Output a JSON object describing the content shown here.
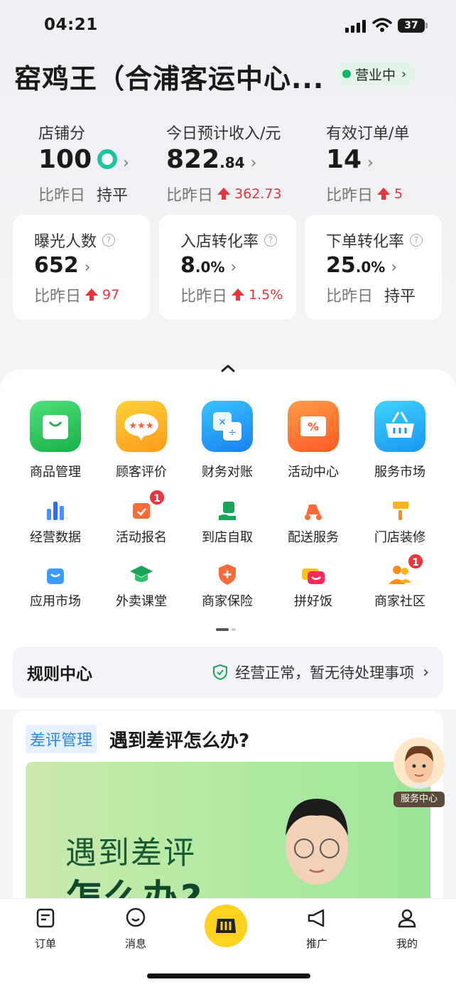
{
  "status_bar": {
    "time": "04:21",
    "battery": "37"
  },
  "store": {
    "name": "窑鸡王（合浦客运中心...",
    "status": "营业中"
  },
  "metrics": [
    {
      "label": "店铺分",
      "value": "100",
      "compare_label": "比昨日",
      "compare_value": "持平"
    },
    {
      "label": "今日预计收入/元",
      "value_main": "822",
      "value_decimal": ".84",
      "compare_label": "比昨日",
      "compare_value": "362.73"
    },
    {
      "label": "有效订单/单",
      "value": "14",
      "compare_label": "比昨日",
      "compare_value": "5"
    }
  ],
  "cards": [
    {
      "label": "曝光人数",
      "value": "652",
      "compare_label": "比昨日",
      "compare_value": "97"
    },
    {
      "label": "入店转化率",
      "value_main": "8",
      "value_decimal": ".0%",
      "compare_label": "比昨日",
      "compare_value": "1.5%"
    },
    {
      "label": "下单转化率",
      "value_main": "25",
      "value_decimal": ".0%",
      "compare_label": "比昨日",
      "compare_value": "持平"
    }
  ],
  "grid": {
    "row1": [
      "商品管理",
      "顾客评价",
      "财务对账",
      "活动中心",
      "服务市场"
    ],
    "row2": [
      "经营数据",
      "活动报名",
      "到店自取",
      "配送服务",
      "门店装修"
    ],
    "row3": [
      "应用市场",
      "外卖课堂",
      "商家保险",
      "拼好饭",
      "商家社区"
    ],
    "badges": {
      "activity_signup": "1",
      "merchant_community": "1"
    }
  },
  "rules": {
    "title": "规则中心",
    "message": "经营正常，暂无待处理事项"
  },
  "feature": {
    "tag": "差评管理",
    "title": "遇到差评怎么办?",
    "banner_line1": "遇到差评",
    "banner_line2": "怎么办?"
  },
  "service_center": "服务中心",
  "tabs": [
    "订单",
    "消息",
    "推广",
    "我的"
  ],
  "colors": {
    "accent": "#ffd21f",
    "up": "#e5363d",
    "open": "#19b46b"
  }
}
